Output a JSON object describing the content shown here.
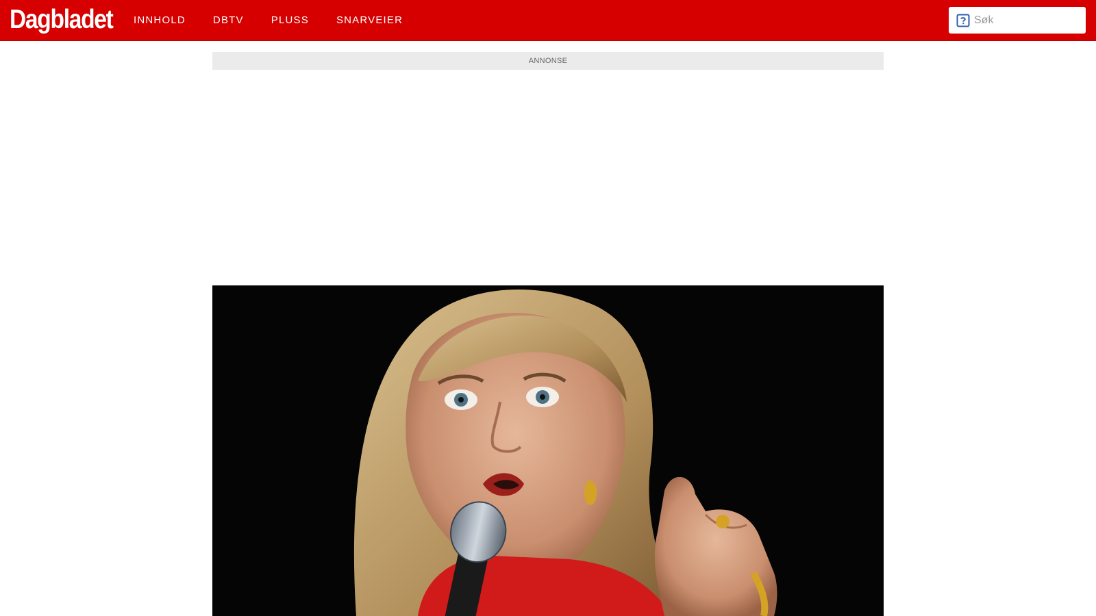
{
  "brand": {
    "logo_text": "Dagbladet",
    "color": "#d60000"
  },
  "nav": {
    "items": [
      {
        "label": "INNHOLD"
      },
      {
        "label": "DBTV"
      },
      {
        "label": "PLUSS"
      },
      {
        "label": "SNARVEIER"
      }
    ]
  },
  "search": {
    "placeholder": "Søk",
    "icon": "search-help-icon"
  },
  "ad": {
    "label": "ANNONSE"
  },
  "article": {
    "hero_image": "photo"
  }
}
